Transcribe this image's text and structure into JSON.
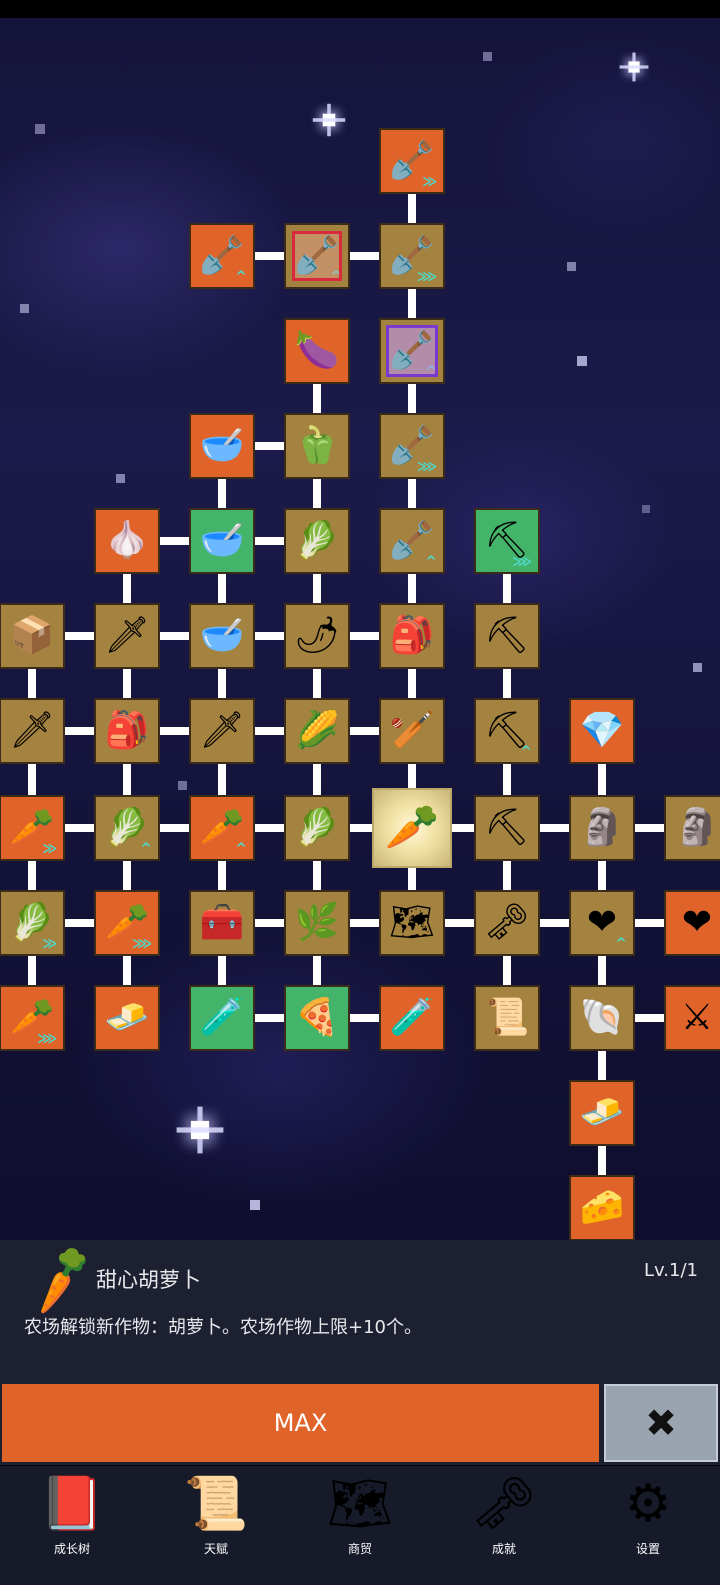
{
  "detail": {
    "icon": "carrot-icon",
    "icon_glyph": "🥕",
    "name": "甜心胡萝卜",
    "level": "Lv.1/1",
    "description": "农场解锁新作物：胡萝卜。农场作物上限+10个。"
  },
  "actions": {
    "max_label": "MAX",
    "close_glyph": "✖"
  },
  "nav": [
    {
      "label": "成长树",
      "icon": "book-icon",
      "glyph": "📕"
    },
    {
      "label": "天赋",
      "icon": "scroll-icon",
      "glyph": "📜"
    },
    {
      "label": "商贸",
      "icon": "map-icon",
      "glyph": "🗺"
    },
    {
      "label": "成就",
      "icon": "key-icon",
      "glyph": "🗝"
    },
    {
      "label": "设置",
      "icon": "gear-icon",
      "glyph": "⚙"
    }
  ],
  "tree_nodes": [
    {
      "id": "n1",
      "icon": "shovel-icon",
      "glyph": "🪏",
      "color": "orange",
      "badge": "≫"
    },
    {
      "id": "n2",
      "icon": "shovel-icon",
      "glyph": "🪏",
      "color": "orange",
      "badge": "^"
    },
    {
      "id": "n3",
      "icon": "shovel-icon",
      "glyph": "🪏",
      "color": "brown",
      "badge": "^",
      "style": "pink"
    },
    {
      "id": "n4",
      "icon": "shovel-icon",
      "glyph": "🪏",
      "color": "brown",
      "badge": "⋙"
    },
    {
      "id": "n5",
      "icon": "eggplant-icon",
      "glyph": "🍆",
      "color": "orange"
    },
    {
      "id": "n6",
      "icon": "shovel-icon",
      "glyph": "🪏",
      "color": "brown",
      "badge": "^",
      "style": "purple"
    },
    {
      "id": "n7",
      "icon": "bowl-icon",
      "glyph": "🥣",
      "color": "orange"
    },
    {
      "id": "n8",
      "icon": "pepper-icon",
      "glyph": "🫑",
      "color": "brown"
    },
    {
      "id": "n9",
      "icon": "shovel-icon",
      "glyph": "🪏",
      "color": "brown",
      "badge": "⋙"
    },
    {
      "id": "n10",
      "icon": "garlic-icon",
      "glyph": "🧄",
      "color": "orange"
    },
    {
      "id": "n11",
      "icon": "bowl-icon",
      "glyph": "🥣",
      "color": "green"
    },
    {
      "id": "n12",
      "icon": "radish-icon",
      "glyph": "🥬",
      "color": "brown"
    },
    {
      "id": "n13",
      "icon": "shovel-icon",
      "glyph": "🪏",
      "color": "brown",
      "badge": "^"
    },
    {
      "id": "n14",
      "icon": "pickaxe-icon",
      "glyph": "⛏",
      "color": "green",
      "badge": "⋙"
    },
    {
      "id": "n15",
      "icon": "crate-icon",
      "glyph": "📦",
      "color": "brown"
    },
    {
      "id": "n16",
      "icon": "sword-icon",
      "glyph": "🗡",
      "color": "brown"
    },
    {
      "id": "n17",
      "icon": "bowl-icon",
      "glyph": "🥣",
      "color": "brown"
    },
    {
      "id": "n18",
      "icon": "chili-icon",
      "glyph": "🌶",
      "color": "brown"
    },
    {
      "id": "n19",
      "icon": "backpack-icon",
      "glyph": "🎒",
      "color": "brown"
    },
    {
      "id": "n20",
      "icon": "pickaxe-icon",
      "glyph": "⛏",
      "color": "brown"
    },
    {
      "id": "n21",
      "icon": "sword-icon",
      "glyph": "🗡",
      "color": "brown"
    },
    {
      "id": "n22",
      "icon": "backpack-icon",
      "glyph": "🎒",
      "color": "brown"
    },
    {
      "id": "n23",
      "icon": "sword-icon",
      "glyph": "🗡",
      "color": "brown"
    },
    {
      "id": "n24",
      "icon": "corn-icon",
      "glyph": "🌽",
      "color": "brown"
    },
    {
      "id": "n25",
      "icon": "club-icon",
      "glyph": "🏏",
      "color": "brown"
    },
    {
      "id": "n26",
      "icon": "pickaxe-icon",
      "glyph": "⛏",
      "color": "brown",
      "badge": "^"
    },
    {
      "id": "n27",
      "icon": "crystal-icon",
      "glyph": "💎",
      "color": "orange"
    },
    {
      "id": "n28",
      "icon": "carrot-icon",
      "glyph": "🥕",
      "color": "orange",
      "badge": "≫"
    },
    {
      "id": "n29",
      "icon": "cabbage-icon",
      "glyph": "🥬",
      "color": "brown",
      "badge": "^"
    },
    {
      "id": "n30",
      "icon": "carrot-icon",
      "glyph": "🥕",
      "color": "orange",
      "badge": "^"
    },
    {
      "id": "n31",
      "icon": "cabbage-icon",
      "glyph": "🥬",
      "color": "brown"
    },
    {
      "id": "n32",
      "icon": "carrot-icon",
      "glyph": "🥕",
      "color": "selected"
    },
    {
      "id": "n33",
      "icon": "pickaxe-icon",
      "glyph": "⛏",
      "color": "brown"
    },
    {
      "id": "n34",
      "icon": "statue-icon",
      "glyph": "🗿",
      "color": "brown"
    },
    {
      "id": "n35",
      "icon": "statue-icon",
      "glyph": "🗿",
      "color": "brown"
    },
    {
      "id": "n36",
      "icon": "cabbage-icon",
      "glyph": "🥬",
      "color": "brown",
      "badge": "≫"
    },
    {
      "id": "n37",
      "icon": "carrot-icon",
      "glyph": "🥕",
      "color": "orange",
      "badge": "⋙"
    },
    {
      "id": "n38",
      "icon": "chest-icon",
      "glyph": "🧰",
      "color": "brown"
    },
    {
      "id": "n39",
      "icon": "leek-icon",
      "glyph": "🌿",
      "color": "brown"
    },
    {
      "id": "n40",
      "icon": "map-icon",
      "glyph": "🗺",
      "color": "brown"
    },
    {
      "id": "n41",
      "icon": "key-icon",
      "glyph": "🗝",
      "color": "brown"
    },
    {
      "id": "n42",
      "icon": "heart-icon",
      "glyph": "❤",
      "color": "brown",
      "badge": "^"
    },
    {
      "id": "n43",
      "icon": "heart-icon",
      "glyph": "❤",
      "color": "orange"
    },
    {
      "id": "n44",
      "icon": "carrot-icon",
      "glyph": "🥕",
      "color": "orange",
      "badge": "⋙"
    },
    {
      "id": "n45",
      "icon": "gold-bar-icon",
      "glyph": "🧈",
      "color": "orange"
    },
    {
      "id": "n46",
      "icon": "potion-icon",
      "glyph": "🧪",
      "color": "green"
    },
    {
      "id": "n47",
      "icon": "pizza-icon",
      "glyph": "🍕",
      "color": "green"
    },
    {
      "id": "n48",
      "icon": "potion-icon",
      "glyph": "🧪",
      "color": "orange"
    },
    {
      "id": "n49",
      "icon": "scroll-icon",
      "glyph": "📜",
      "color": "brown"
    },
    {
      "id": "n50",
      "icon": "fossil-icon",
      "glyph": "🐚",
      "color": "brown"
    },
    {
      "id": "n51",
      "icon": "sword-icon",
      "glyph": "⚔",
      "color": "orange"
    },
    {
      "id": "n52",
      "icon": "butter-icon",
      "glyph": "🧈",
      "color": "orange"
    },
    {
      "id": "n53",
      "icon": "cheese-icon",
      "glyph": "🧀",
      "color": "orange"
    }
  ]
}
